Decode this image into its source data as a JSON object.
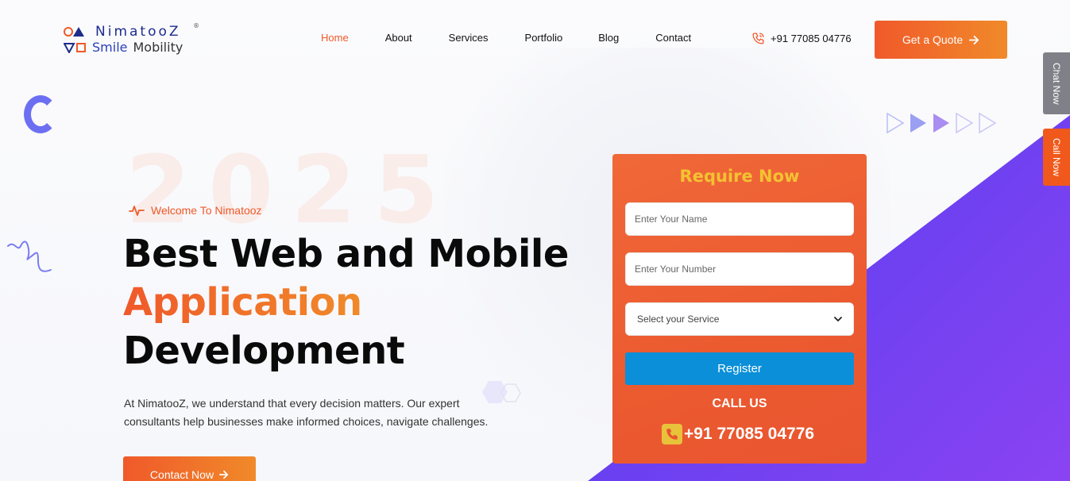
{
  "brand": {
    "line1": "NimatooZ",
    "line2a": "Smile",
    "line2b": "Mobility",
    "registered": "®",
    "colors": {
      "orange": "#f0592a",
      "blue": "#1e2c8c",
      "gold": "#f3c232",
      "register_blue": "#0a8fd8"
    }
  },
  "nav": {
    "items": [
      {
        "label": "Home",
        "active": true
      },
      {
        "label": "About",
        "active": false
      },
      {
        "label": "Services",
        "active": false
      },
      {
        "label": "Portfolio",
        "active": false
      },
      {
        "label": "Blog",
        "active": false
      },
      {
        "label": "Contact",
        "active": false
      }
    ]
  },
  "header": {
    "phone": "+91 77085 04776",
    "quote_label": "Get a Quote",
    "phone_icon": "phone-ring-icon",
    "quote_icon": "arrow-right-icon"
  },
  "side_tabs": {
    "chat": "Chat Now",
    "call": "Call Now"
  },
  "hero": {
    "watermark": "2025",
    "welcome": "Welcome To Nimatooz",
    "title_line1": "Best Web and Mobile",
    "title_line2": "Application",
    "title_line3": "Development",
    "description": "At NimatooZ, we understand that every decision matters. Our expert consultants help businesses make informed choices, navigate challenges.",
    "contact_label": "Contact Now"
  },
  "form": {
    "title": "Require Now",
    "name_placeholder": "Enter Your Name",
    "number_placeholder": "Enter Your Number",
    "service_selected": "Select your Service",
    "register_label": "Register",
    "call_us": "CALL US",
    "phone": "+91 77085 04776"
  }
}
